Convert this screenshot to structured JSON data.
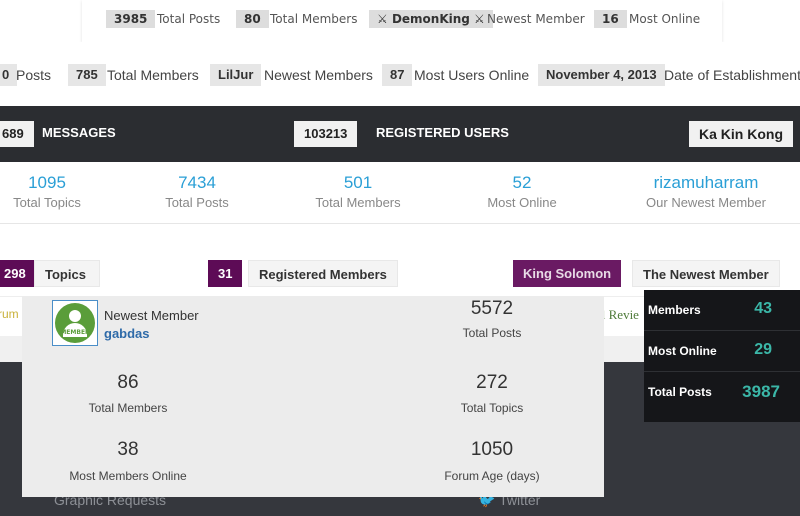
{
  "row1": {
    "total_posts": "3985",
    "total_posts_label": "Total Posts",
    "total_members": "80",
    "total_members_label": "Total Members",
    "newest_member": "DemonKing",
    "newest_member_label": "Newest Member",
    "most_online": "16",
    "most_online_label": "Most Online"
  },
  "row2": {
    "posts": "0",
    "posts_label": "Posts",
    "total_members": "785",
    "total_members_label": "Total Members",
    "newest_member": "LilJur",
    "newest_member_label": "Newest Members",
    "most_online": "87",
    "most_online_label": "Most Users Online",
    "est_date": "November 4, 2013",
    "est_label": "Date of Establishment o"
  },
  "dark_bar": {
    "messages_value": "689",
    "messages_label": "MESSAGES",
    "users_value": "103213",
    "users_label": "REGISTERED USERS",
    "newest_user": "Ka Kin Kong"
  },
  "stats": [
    {
      "num": "1095",
      "cap": "Total Topics"
    },
    {
      "num": "7434",
      "cap": "Total Posts"
    },
    {
      "num": "501",
      "cap": "Total Members"
    },
    {
      "num": "52",
      "cap": "Most Online"
    },
    {
      "num": "rizamuharram",
      "cap": "Our Newest Member"
    }
  ],
  "purple_row": {
    "topics_value": "298",
    "topics_label": "Topics",
    "members_value": "31",
    "members_label": "Registered Members",
    "newest_value": "King Solomon",
    "newest_label": "The Newest Member"
  },
  "strip": {
    "left_text": "rum",
    "right_text": "al Revie"
  },
  "panel": {
    "newest_label": "Newest Member",
    "newest_name": "gabdas",
    "avatar_word": "MEMBER",
    "posts_value": "5572",
    "posts_label": "Total Posts",
    "members_value": "86",
    "members_label": "Total Members",
    "topics_value": "272",
    "topics_label": "Total Topics",
    "online_value": "38",
    "online_label": "Most Members Online",
    "age_value": "1050",
    "age_label": "Forum Age (days)"
  },
  "widget": {
    "rows": [
      {
        "label": "Members",
        "value": "43"
      },
      {
        "label": "Most Online",
        "value": "29"
      },
      {
        "label": "Total Posts",
        "value": "3987"
      }
    ]
  },
  "footer": {
    "left_link": "Graphic Requests",
    "right_link": "Twitter"
  }
}
